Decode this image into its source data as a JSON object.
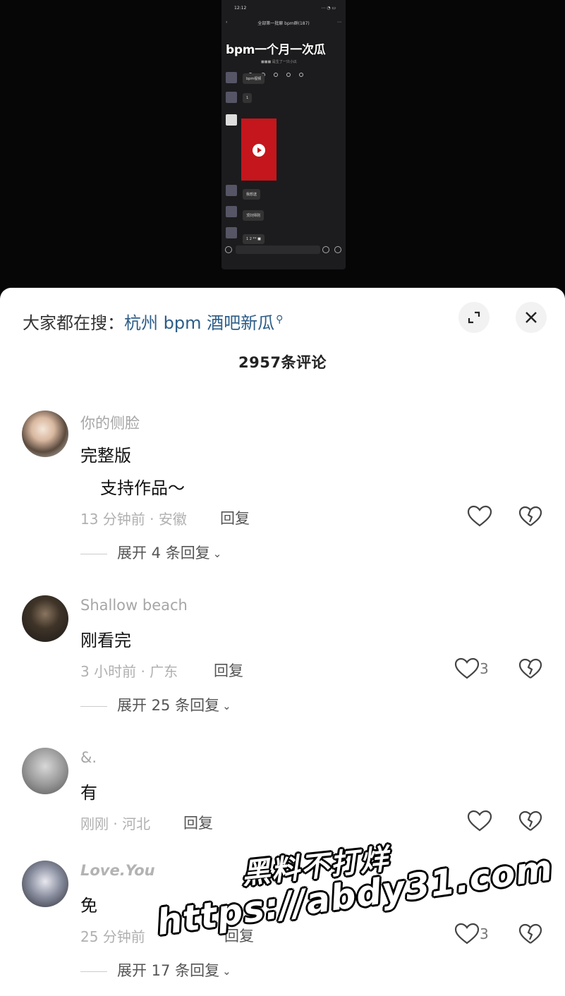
{
  "phone_preview": {
    "status_time": "12:12",
    "status_right": "⋯ ◔ ▭",
    "chat_title": "全部第一批聊 bpm群(187)",
    "overlay_title": "bpm一个月一次瓜",
    "overlay_sub": "■■■ 是生了一只小瓜",
    "msg1": "bpm视频",
    "msg2": "1",
    "msg3": "我想送",
    "msg4": "顶刘师则",
    "msg5": "1 2 ** ■"
  },
  "search": {
    "label": "大家都在搜：",
    "term": "杭州 bpm 酒吧新瓜"
  },
  "comment_count": "2957条评论",
  "comments": [
    {
      "username": "你的侧脸",
      "lines": [
        "完整版",
        "支持作品～"
      ],
      "time_loc": "13 分钟前 · 安徽",
      "reply": "回复",
      "likes": "",
      "expand": "展开 4 条回复"
    },
    {
      "username": "Shallow beach",
      "lines": [
        "刚看完"
      ],
      "time_loc": "3 小时前 · 广东",
      "reply": "回复",
      "likes": "3",
      "expand": "展开 25 条回复"
    },
    {
      "username": "&.",
      "lines": [
        "有"
      ],
      "time_loc": "刚刚 · 河北",
      "reply": "回复",
      "likes": "",
      "expand": ""
    },
    {
      "username": "Love.You",
      "lines": [
        "免"
      ],
      "time_loc": "25 分钟前",
      "reply": "回复",
      "likes": "3",
      "expand": "展开 17 条回复"
    }
  ],
  "watermark": {
    "line1": "黑料不打烊",
    "line2": "https://abdy31.com"
  }
}
